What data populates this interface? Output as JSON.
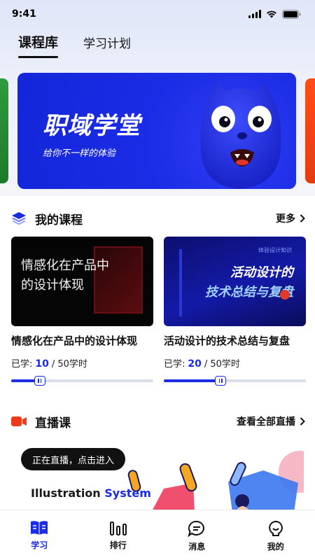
{
  "status_bar": {
    "time": "9:41"
  },
  "tabs": [
    {
      "label": "课程库",
      "active": true
    },
    {
      "label": "学习计划",
      "active": false
    }
  ],
  "banner": {
    "title": "职域学堂",
    "subtitle": "给你不一样的体验"
  },
  "my_courses": {
    "title": "我的课程",
    "more_label": "更多",
    "icon": "layers-icon",
    "items": [
      {
        "thumb_text_line1": "情感化在产品中",
        "thumb_text_line2": "的设计体现",
        "title": "情感化在产品中的设计体现",
        "learned_label": "已学:",
        "learned": 10,
        "total_label": "/ 50学时",
        "total": 50,
        "progress": 0.2
      },
      {
        "thumb_tag": "体验设计知识",
        "thumb_text_line1": "活动设计的",
        "thumb_text_line2": "技术总结与复盘",
        "title": "活动设计的技术总结与复盘",
        "learned_label": "已学:",
        "learned": 20,
        "total_label": "/ 50学时",
        "total": 50,
        "progress": 0.4
      }
    ]
  },
  "live": {
    "title": "直播课",
    "more_label": "查看全部直播",
    "icon": "camera-icon",
    "tip": "正在直播，点击进入",
    "illustration_title_a": "Illustration",
    "illustration_title_b": "System"
  },
  "bottom_nav": [
    {
      "label": "学习",
      "icon": "book-icon",
      "active": true
    },
    {
      "label": "排行",
      "icon": "bar-chart-icon",
      "active": false
    },
    {
      "label": "消息",
      "icon": "chat-icon",
      "active": false
    },
    {
      "label": "我的",
      "icon": "user-icon",
      "active": false
    }
  ],
  "colors": {
    "accent": "#1b2ce6",
    "live_red": "#ef3b1c",
    "text": "#111111"
  }
}
